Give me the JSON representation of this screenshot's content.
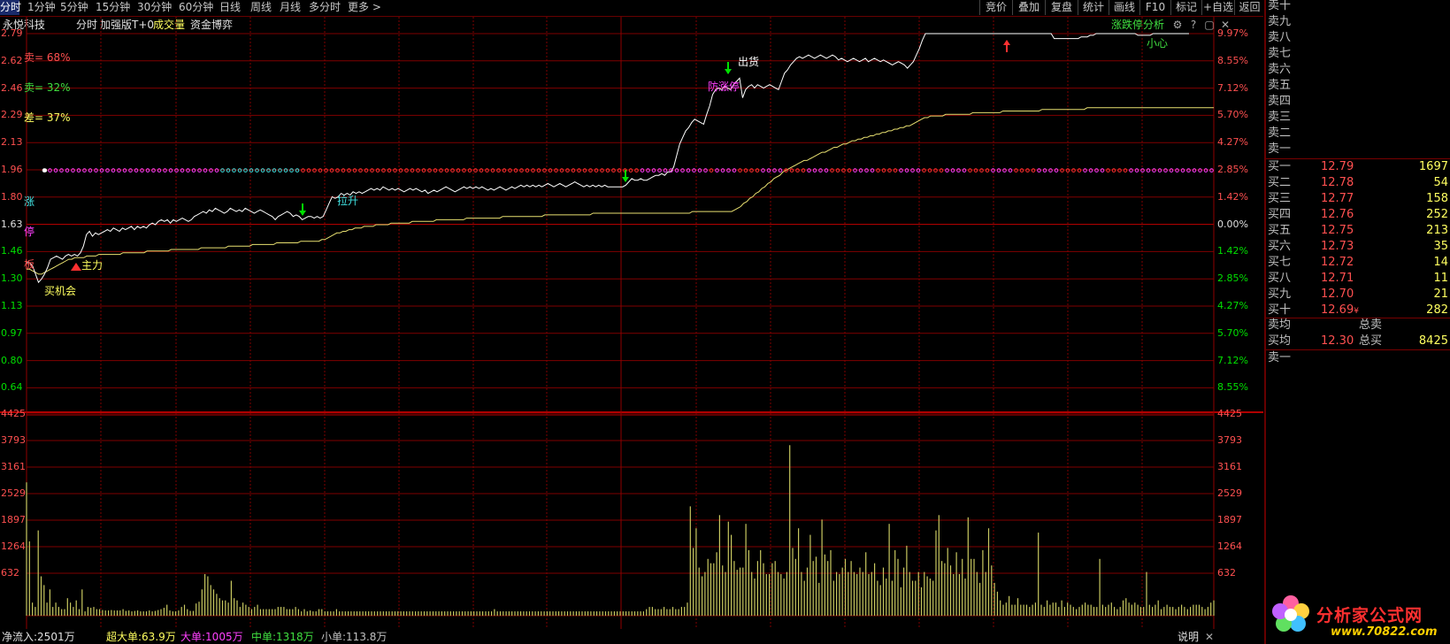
{
  "tabs": [
    "分时",
    "1分钟",
    "5分钟",
    "15分钟",
    "30分钟",
    "60分钟",
    "日线",
    "周线",
    "月线",
    "多分时",
    "更多 >"
  ],
  "right_buttons": [
    "竞价",
    "叠加",
    "复盘",
    "统计",
    "画线",
    "F10",
    "标记",
    "+自选",
    "返回"
  ],
  "info": {
    "name": "永悦科技",
    "mode": "分时",
    "version": "加强版T+0",
    "volume": "成交量",
    "game": "资金博弈"
  },
  "analysis": {
    "label": "涨跌停分析",
    "settings_icon": "gear-icon",
    "help_icon": "help-icon",
    "restore_icon": "restore-icon",
    "close_icon": "close-icon"
  },
  "price_axis": {
    "left": [
      "2.79",
      "2.62",
      "2.46",
      "2.29",
      "2.13",
      "1.96",
      "1.80",
      "1.63",
      "1.46",
      "1.30",
      "1.13",
      "0.97",
      "0.80",
      "0.64"
    ],
    "right": [
      "9.97%",
      "8.55%",
      "7.12%",
      "5.70%",
      "4.27%",
      "2.85%",
      "1.42%",
      "0.00%",
      "1.42%",
      "2.85%",
      "4.27%",
      "5.70%",
      "7.12%",
      "8.55%"
    ]
  },
  "volume_axis": {
    "left": [
      "4425",
      "3793",
      "3161",
      "2529",
      "1897",
      "1264",
      "632"
    ],
    "right": [
      "4425",
      "3793",
      "3161",
      "2529",
      "1897",
      "1264",
      "632"
    ]
  },
  "indicators": {
    "sell": "卖= 68%",
    "buy": "卖= 32%",
    "diff": "差= 37%",
    "zhang": "涨",
    "ting": "停",
    "ban": "板"
  },
  "annotations": {
    "zhuli": "主力",
    "mai_jihui": "买机会",
    "la_sheng": "拉升",
    "chu_huo": "出货",
    "fang_zhangting": "防涨停",
    "xiao_xin": "小心"
  },
  "colors": {
    "up": "#ff5050",
    "down": "#00e000",
    "grid": "#800000",
    "price_line": "#ffffff",
    "avg_line": "#e8e070",
    "volume": "#c8c860",
    "accent_yellow": "#ffff60",
    "magenta": "#ff40ff",
    "cyan": "#40e0e0"
  },
  "order_book": {
    "sell": [
      {
        "name": "卖十"
      },
      {
        "name": "卖九"
      },
      {
        "name": "卖八"
      },
      {
        "name": "卖七"
      },
      {
        "name": "卖六"
      },
      {
        "name": "卖五"
      },
      {
        "name": "卖四"
      },
      {
        "name": "卖三"
      },
      {
        "name": "卖二"
      },
      {
        "name": "卖一"
      }
    ],
    "buy": [
      {
        "name": "买一",
        "price": "12.79",
        "vol": "1697"
      },
      {
        "name": "买二",
        "price": "12.78",
        "vol": "54"
      },
      {
        "name": "买三",
        "price": "12.77",
        "vol": "158"
      },
      {
        "name": "买四",
        "price": "12.76",
        "vol": "252"
      },
      {
        "name": "买五",
        "price": "12.75",
        "vol": "213"
      },
      {
        "name": "买六",
        "price": "12.73",
        "vol": "35"
      },
      {
        "name": "买七",
        "price": "12.72",
        "vol": "14"
      },
      {
        "name": "买八",
        "price": "12.71",
        "vol": "11"
      },
      {
        "name": "买九",
        "price": "12.70",
        "vol": "21"
      },
      {
        "name": "买十",
        "price": "12.69",
        "vol": "282",
        "mark": "¥"
      }
    ],
    "avg_sell": {
      "label": "卖均",
      "total_label": "总卖"
    },
    "avg_buy": {
      "label": "买均",
      "price": "12.30",
      "total_label": "总买",
      "total": "8425"
    },
    "last": "卖一"
  },
  "bottom": {
    "net": "净流入:2501万",
    "super": "超大单:63.9万",
    "large": "大单:1005万",
    "medium": "中单:1318万",
    "small": "小单:113.8万",
    "help": "说明"
  },
  "logo": {
    "name": "分析家公式网",
    "url": "www.70822.com"
  },
  "price_series": [
    1.4,
    1.4,
    1.38,
    1.33,
    1.28,
    1.3,
    1.33,
    1.37,
    1.42,
    1.43,
    1.44,
    1.43,
    1.42,
    1.44,
    1.45,
    1.44,
    1.45,
    1.44,
    1.46,
    1.5,
    1.57,
    1.59,
    1.56,
    1.58,
    1.57,
    1.58,
    1.59,
    1.6,
    1.59,
    1.61,
    1.6,
    1.59,
    1.61,
    1.6,
    1.61,
    1.62,
    1.6,
    1.62,
    1.61,
    1.62,
    1.61,
    1.63,
    1.64,
    1.63,
    1.65,
    1.66,
    1.65,
    1.66,
    1.64,
    1.66,
    1.65,
    1.66,
    1.67,
    1.66,
    1.65,
    1.66,
    1.68,
    1.69,
    1.7,
    1.71,
    1.7,
    1.72,
    1.71,
    1.73,
    1.72,
    1.71,
    1.7,
    1.71,
    1.73,
    1.72,
    1.71,
    1.72,
    1.71,
    1.73,
    1.72,
    1.71,
    1.7,
    1.71,
    1.72,
    1.71,
    1.7,
    1.69,
    1.68,
    1.66,
    1.68,
    1.69,
    1.7,
    1.71,
    1.7,
    1.68,
    1.69,
    1.68,
    1.66,
    1.67,
    1.68,
    1.68,
    1.67,
    1.68,
    1.67,
    1.68,
    1.72,
    1.76,
    1.8,
    1.79,
    1.8,
    1.82,
    1.81,
    1.82,
    1.81,
    1.83,
    1.82,
    1.83,
    1.82,
    1.83,
    1.84,
    1.85,
    1.84,
    1.85,
    1.84,
    1.86,
    1.85,
    1.84,
    1.85,
    1.84,
    1.85,
    1.84,
    1.83,
    1.84,
    1.85,
    1.84,
    1.85,
    1.84,
    1.83,
    1.84,
    1.82,
    1.83,
    1.84,
    1.83,
    1.84,
    1.85,
    1.86,
    1.85,
    1.84,
    1.83,
    1.84,
    1.85,
    1.86,
    1.85,
    1.86,
    1.85,
    1.86,
    1.85,
    1.86,
    1.85,
    1.84,
    1.85,
    1.84,
    1.85,
    1.86,
    1.85,
    1.84,
    1.85,
    1.86,
    1.85,
    1.86,
    1.87,
    1.86,
    1.87,
    1.86,
    1.87,
    1.86,
    1.87,
    1.86,
    1.87,
    1.88,
    1.87,
    1.86,
    1.87,
    1.88,
    1.87,
    1.86,
    1.87,
    1.88,
    1.89,
    1.88,
    1.87,
    1.86,
    1.87,
    1.86,
    1.87,
    1.86,
    1.87,
    1.86,
    1.87,
    1.86,
    1.86,
    1.86,
    1.86,
    1.86,
    1.86,
    1.87,
    1.89,
    1.91,
    1.9,
    1.9,
    1.91,
    1.9,
    1.9,
    1.91,
    1.92,
    1.93,
    1.93,
    1.94,
    1.93,
    1.95,
    1.95,
    1.98,
    2.05,
    2.12,
    2.16,
    2.2,
    2.22,
    2.25,
    2.27,
    2.26,
    2.25,
    2.24,
    2.3,
    2.35,
    2.42,
    2.45,
    2.46,
    2.45,
    2.47,
    2.46,
    2.45,
    2.48,
    2.5,
    2.52,
    2.4,
    2.45,
    2.47,
    2.48,
    2.46,
    2.48,
    2.47,
    2.46,
    2.47,
    2.48,
    2.47,
    2.46,
    2.45,
    2.5,
    2.55,
    2.57,
    2.6,
    2.62,
    2.64,
    2.65,
    2.64,
    2.65,
    2.66,
    2.65,
    2.64,
    2.65,
    2.66,
    2.65,
    2.64,
    2.65,
    2.66,
    2.65,
    2.63,
    2.64,
    2.63,
    2.62,
    2.63,
    2.64,
    2.63,
    2.62,
    2.63,
    2.64,
    2.62,
    2.63,
    2.64,
    2.63,
    2.62,
    2.63,
    2.62,
    2.61,
    2.6,
    2.61,
    2.62,
    2.61,
    2.6,
    2.58,
    2.6,
    2.62,
    2.66,
    2.7,
    2.75,
    2.79,
    2.79,
    2.79,
    2.79,
    2.79,
    2.79,
    2.79,
    2.79,
    2.79,
    2.79,
    2.79,
    2.79,
    2.79,
    2.79,
    2.79,
    2.79,
    2.79,
    2.79,
    2.79,
    2.79,
    2.79,
    2.79,
    2.79,
    2.79,
    2.79,
    2.79,
    2.79,
    2.79,
    2.79,
    2.79,
    2.79,
    2.79,
    2.79,
    2.79,
    2.79,
    2.79,
    2.79,
    2.79,
    2.79,
    2.79,
    2.79,
    2.79,
    2.79,
    2.76,
    2.76,
    2.76,
    2.76,
    2.76,
    2.76,
    2.76,
    2.76,
    2.76,
    2.77,
    2.77,
    2.77,
    2.78,
    2.78,
    2.79,
    2.79,
    2.79,
    2.79,
    2.79,
    2.79,
    2.79,
    2.79,
    2.79,
    2.79,
    2.79,
    2.79,
    2.79,
    2.79,
    2.78,
    2.78,
    2.78,
    2.78,
    2.78,
    2.79,
    2.79,
    2.79,
    2.79,
    2.79,
    2.79,
    2.79,
    2.79,
    2.79,
    2.79,
    2.79,
    2.79,
    2.79
  ],
  "avg_series": [
    1.36,
    1.36,
    1.35,
    1.34,
    1.33,
    1.33,
    1.34,
    1.35,
    1.36,
    1.37,
    1.38,
    1.39,
    1.4,
    1.41,
    1.42,
    1.42,
    1.43,
    1.43,
    1.43,
    1.43,
    1.44,
    1.44,
    1.44,
    1.44,
    1.45,
    1.45,
    1.45,
    1.45,
    1.45,
    1.45,
    1.45,
    1.45,
    1.46,
    1.46,
    1.46,
    1.46,
    1.46,
    1.46,
    1.46,
    1.46,
    1.47,
    1.47,
    1.47,
    1.47,
    1.47,
    1.47,
    1.47,
    1.47,
    1.48,
    1.48,
    1.48,
    1.48,
    1.48,
    1.48,
    1.48,
    1.48,
    1.48,
    1.48,
    1.49,
    1.49,
    1.49,
    1.49,
    1.49,
    1.49,
    1.49,
    1.49,
    1.49,
    1.5,
    1.5,
    1.5,
    1.5,
    1.5,
    1.5,
    1.5,
    1.5,
    1.51,
    1.51,
    1.51,
    1.51,
    1.51,
    1.51,
    1.51,
    1.51,
    1.52,
    1.52,
    1.52,
    1.52,
    1.52,
    1.52,
    1.52,
    1.52,
    1.53,
    1.53,
    1.53,
    1.53,
    1.53,
    1.53,
    1.53,
    1.54,
    1.54,
    1.55,
    1.56,
    1.57,
    1.58,
    1.58,
    1.59,
    1.59,
    1.6,
    1.6,
    1.61,
    1.61,
    1.61,
    1.62,
    1.62,
    1.62,
    1.62,
    1.63,
    1.63,
    1.63,
    1.63,
    1.63,
    1.64,
    1.64,
    1.64,
    1.64,
    1.64,
    1.64,
    1.64,
    1.65,
    1.65,
    1.65,
    1.65,
    1.65,
    1.65,
    1.65,
    1.65,
    1.66,
    1.66,
    1.66,
    1.66,
    1.66,
    1.66,
    1.66,
    1.66,
    1.66,
    1.66,
    1.67,
    1.67,
    1.67,
    1.67,
    1.67,
    1.67,
    1.67,
    1.67,
    1.67,
    1.67,
    1.67,
    1.67,
    1.68,
    1.68,
    1.68,
    1.68,
    1.68,
    1.68,
    1.68,
    1.68,
    1.68,
    1.68,
    1.68,
    1.68,
    1.68,
    1.68,
    1.69,
    1.69,
    1.69,
    1.69,
    1.69,
    1.69,
    1.69,
    1.69,
    1.69,
    1.69,
    1.69,
    1.69,
    1.69,
    1.69,
    1.69,
    1.69,
    1.7,
    1.7,
    1.7,
    1.7,
    1.7,
    1.7,
    1.7,
    1.7,
    1.7,
    1.7,
    1.7,
    1.7,
    1.7,
    1.7,
    1.7,
    1.7,
    1.7,
    1.7,
    1.7,
    1.7,
    1.7,
    1.7,
    1.7,
    1.7,
    1.7,
    1.7,
    1.7,
    1.7,
    1.7,
    1.7,
    1.7,
    1.7,
    1.7,
    1.71,
    1.71,
    1.71,
    1.71,
    1.71,
    1.71,
    1.71,
    1.71,
    1.71,
    1.71,
    1.71,
    1.71,
    1.71,
    1.71,
    1.72,
    1.73,
    1.74,
    1.76,
    1.77,
    1.79,
    1.8,
    1.82,
    1.83,
    1.85,
    1.86,
    1.88,
    1.89,
    1.91,
    1.92,
    1.93,
    1.95,
    1.96,
    1.97,
    1.98,
    1.99,
    2.0,
    2.01,
    2.02,
    2.02,
    2.03,
    2.04,
    2.05,
    2.06,
    2.07,
    2.07,
    2.08,
    2.09,
    2.1,
    2.1,
    2.11,
    2.12,
    2.12,
    2.13,
    2.14,
    2.14,
    2.15,
    2.15,
    2.16,
    2.16,
    2.17,
    2.17,
    2.18,
    2.18,
    2.19,
    2.19,
    2.2,
    2.2,
    2.21,
    2.21,
    2.22,
    2.22,
    2.23,
    2.23,
    2.24,
    2.25,
    2.26,
    2.27,
    2.28,
    2.28,
    2.29,
    2.29,
    2.29,
    2.29,
    2.29,
    2.3,
    2.3,
    2.3,
    2.3,
    2.3,
    2.3,
    2.3,
    2.3,
    2.3,
    2.31,
    2.31,
    2.31,
    2.31,
    2.31,
    2.31,
    2.31,
    2.31,
    2.31,
    2.31,
    2.32,
    2.32,
    2.32,
    2.32,
    2.32,
    2.32,
    2.32,
    2.32,
    2.32,
    2.32,
    2.32,
    2.32,
    2.32,
    2.33,
    2.33,
    2.33,
    2.33,
    2.33,
    2.33,
    2.33,
    2.33,
    2.33,
    2.33,
    2.33,
    2.33,
    2.33,
    2.33,
    2.33,
    2.34,
    2.34,
    2.34,
    2.34,
    2.34,
    2.34,
    2.34,
    2.34,
    2.34,
    2.34,
    2.34,
    2.34,
    2.34,
    2.34,
    2.34,
    2.34,
    2.34,
    2.34,
    2.34,
    2.34,
    2.34,
    2.34,
    2.34,
    2.34,
    2.34,
    2.34,
    2.34,
    2.34,
    2.34,
    2.34,
    2.34,
    2.34,
    2.34,
    2.34,
    2.34,
    2.34,
    2.34,
    2.34,
    2.34,
    2.34,
    2.34,
    2.34,
    2.34
  ],
  "volume_series": [
    3050,
    1700,
    300,
    200,
    1950,
    900,
    700,
    300,
    600,
    200,
    300,
    200,
    150,
    150,
    400,
    300,
    200,
    350,
    150,
    600,
    100,
    200,
    180,
    200,
    150,
    150,
    130,
    120,
    120,
    130,
    120,
    120,
    120,
    150,
    110,
    120,
    100,
    110,
    120,
    100,
    100,
    100,
    120,
    100,
    110,
    130,
    150,
    180,
    250,
    120,
    100,
    100,
    120,
    200,
    250,
    150,
    110,
    110,
    280,
    320,
    600,
    950,
    900,
    700,
    600,
    500,
    400,
    350,
    350,
    300,
    800,
    400,
    350,
    200,
    300,
    250,
    200,
    150,
    200,
    250,
    150,
    150,
    150,
    150,
    150,
    150,
    200,
    200,
    200,
    150,
    150,
    150,
    200,
    150,
    100,
    150,
    100,
    120,
    100,
    100,
    150,
    150,
    100,
    100,
    100,
    100,
    150,
    100,
    100,
    100,
    100,
    100,
    100,
    100,
    100,
    100,
    100,
    100,
    100,
    100,
    100,
    100,
    100,
    100,
    100,
    100,
    100,
    100,
    100,
    100,
    100,
    100,
    100,
    100,
    100,
    100,
    100,
    100,
    100,
    100,
    100,
    100,
    100,
    100,
    100,
    100,
    100,
    100,
    100,
    100,
    100,
    100,
    100,
    100,
    100,
    100,
    100,
    100,
    100,
    100,
    150,
    100,
    100,
    100,
    100,
    100,
    100,
    100,
    100,
    100,
    100,
    100,
    100,
    100,
    100,
    100,
    100,
    100,
    100,
    100,
    100,
    100,
    100,
    100,
    100,
    100,
    100,
    100,
    100,
    100,
    100,
    100,
    100,
    100,
    100,
    100,
    100,
    100,
    100,
    100,
    100,
    100,
    100,
    100,
    100,
    100,
    100,
    100,
    100,
    100,
    100,
    100,
    150,
    200,
    200,
    150,
    150,
    150,
    200,
    150,
    150,
    200,
    150,
    150,
    200,
    200,
    300,
    2500,
    1550,
    2000,
    1100,
    900,
    1000,
    1300,
    1200,
    1200,
    1450,
    2300,
    1150,
    1000,
    2150,
    1850,
    1250,
    1050,
    1100,
    1100,
    2100,
    1500,
    1000,
    850,
    1250,
    1500,
    1200,
    950,
    950,
    1200,
    1250,
    1000,
    950,
    850,
    1000,
    3900,
    1550,
    1300,
    2000,
    1000,
    800,
    1100,
    1850,
    1250,
    1350,
    750,
    2200,
    1400,
    1250,
    1500,
    800,
    1000,
    950,
    1100,
    1300,
    1000,
    1250,
    1000,
    950,
    1100,
    1000,
    1450,
    950,
    1000,
    1200,
    800,
    700,
    1100,
    850,
    2100,
    800,
    1500,
    1300,
    650,
    1100,
    1600,
    1000,
    800,
    800,
    1000,
    650,
    1000,
    900,
    850,
    800,
    1950,
    2300,
    1250,
    1200,
    1550,
    1150,
    950,
    1450,
    950,
    1300,
    850,
    2250,
    1300,
    1300,
    1000,
    750,
    1500,
    1000,
    2000,
    1150,
    750,
    550,
    350,
    250,
    300,
    450,
    250,
    250,
    400,
    250,
    250,
    250,
    200,
    250,
    300,
    1900,
    250,
    200,
    350,
    250,
    300,
    300,
    200,
    350,
    200,
    300,
    250,
    200,
    150,
    200,
    250,
    300,
    250,
    250,
    200,
    200,
    1300,
    250,
    200,
    250,
    300,
    200,
    150,
    200,
    350,
    400,
    300,
    250,
    300,
    250,
    200,
    200,
    1000,
    250,
    200,
    250,
    350,
    150,
    200,
    250,
    200,
    200,
    150,
    200,
    250,
    200,
    150,
    200,
    250,
    250,
    250,
    200,
    150,
    200,
    300,
    350
  ]
}
